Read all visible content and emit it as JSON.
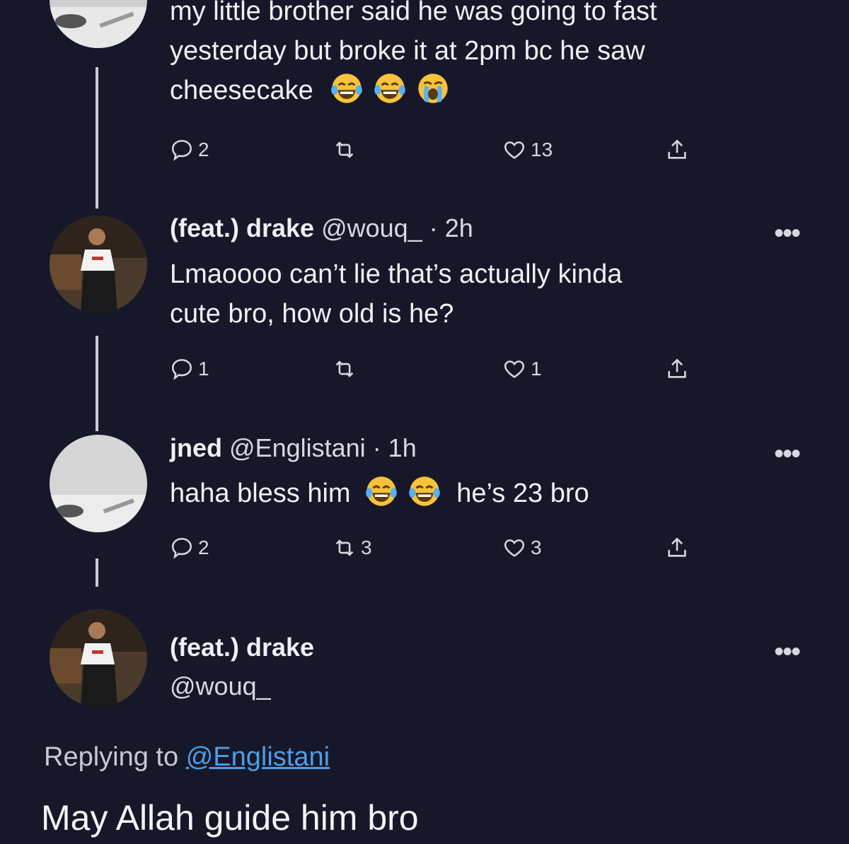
{
  "tweet1": {
    "text_line1": "my little brother said he was going to fast",
    "text_line2": "yesterday but broke it at 2pm bc he saw",
    "text_line3": "cheesecake",
    "replies": "2",
    "retweets": "",
    "likes": "13"
  },
  "tweet2": {
    "name": "(feat.) drake",
    "handle": "@wouq_",
    "time": "· 2h",
    "text_line1": "Lmaoooo can’t lie that’s actually kinda",
    "text_line2": "cute bro, how old is he?",
    "replies": "1",
    "retweets": "",
    "likes": "1"
  },
  "tweet3": {
    "name": "jned",
    "handle": "@Englistani",
    "time": "· 1h",
    "text_before": "haha bless him",
    "text_after": "he’s 23 bro",
    "replies": "2",
    "retweets": "3",
    "likes": "3"
  },
  "main_tweet": {
    "name": "(feat.) drake",
    "handle": "@wouq_",
    "replying_label": "Replying to",
    "replying_handle": "@Englistani",
    "text": "May Allah guide him bro"
  },
  "more_label": "•••",
  "icons": [
    "reply-icon",
    "retweet-icon",
    "like-icon",
    "share-icon",
    "laughing-emoji",
    "crying-emoji"
  ]
}
